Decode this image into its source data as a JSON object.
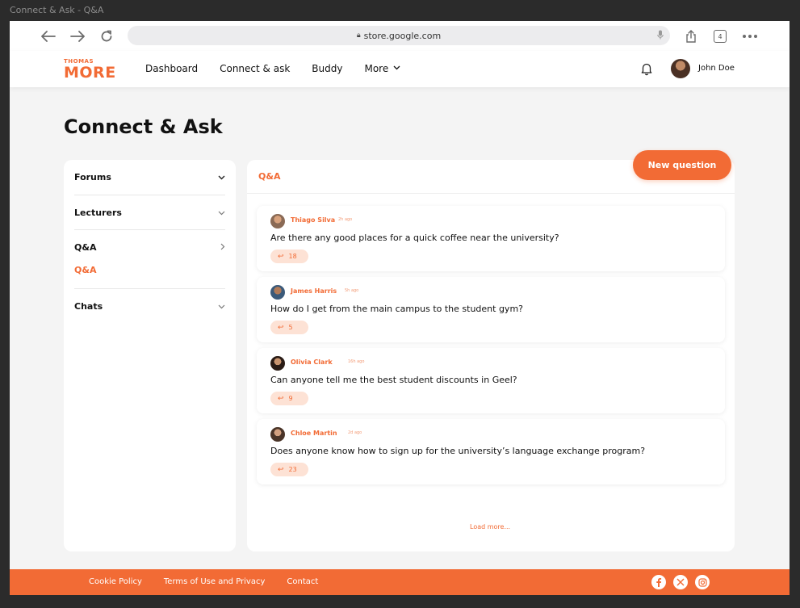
{
  "window": {
    "title": "Connect & Ask - Q&A"
  },
  "browser": {
    "url": "store.google.com",
    "tab_count": "4"
  },
  "header": {
    "logo_top": "THOMAS",
    "logo_main": "MORE",
    "nav": [
      "Dashboard",
      "Connect & ask",
      "Buddy",
      "More"
    ],
    "user_name": "John Doe"
  },
  "page": {
    "title": "Connect & Ask"
  },
  "sidebar": {
    "items": [
      {
        "label": "Forums"
      },
      {
        "label": "Lecturers"
      },
      {
        "label": "Q&A",
        "sub": "Q&A"
      },
      {
        "label": "Chats"
      }
    ]
  },
  "main": {
    "tab": "Q&A",
    "new_question_label": "New question",
    "questions": [
      {
        "author": "Thiago Silva",
        "time": "2h ago",
        "text": "Are there any good places for a quick coffee near the university?",
        "replies": "18"
      },
      {
        "author": "James Harris",
        "time": "5h ago",
        "text": "How do I get from the main campus to the student gym?",
        "replies": "5"
      },
      {
        "author": "Olivia Clark",
        "time": "16h ago",
        "text": "Can anyone tell me the best student discounts in Geel?",
        "replies": "9"
      },
      {
        "author": "Chloe Martin",
        "time": "2d ago",
        "text": "Does anyone know how to sign up for the university’s language exchange program?",
        "replies": "23"
      }
    ],
    "load_more": "Load more..."
  },
  "footer": {
    "links": [
      "Cookie Policy",
      "Terms of Use and Privacy",
      "Contact"
    ],
    "social": [
      "facebook-icon",
      "x-icon",
      "instagram-icon"
    ]
  },
  "colors": {
    "accent": "#f26b35",
    "accent_light": "#fde2d5",
    "background": "#f4f4f4"
  }
}
